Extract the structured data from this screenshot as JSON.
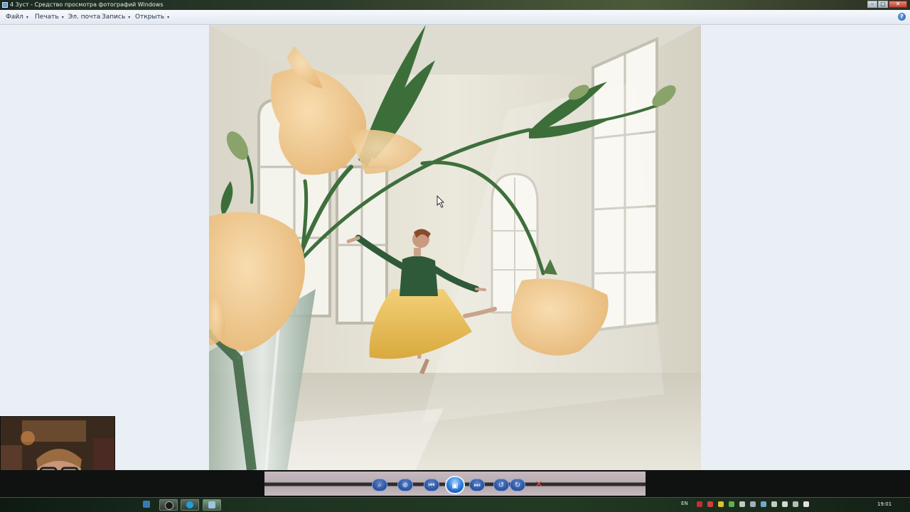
{
  "window": {
    "title": "4 3уст - Средство просмотра фотографий Windows",
    "controls": [
      "minimize",
      "maximize",
      "close"
    ]
  },
  "menubar": {
    "items": [
      {
        "label": "Файл",
        "has_dropdown": true
      },
      {
        "label": "Печать",
        "has_dropdown": true
      },
      {
        "label": "Эл. почта",
        "has_dropdown": false
      },
      {
        "label": "Запись",
        "has_dropdown": true
      },
      {
        "label": "Открыть",
        "has_dropdown": true
      }
    ],
    "help_icon": "help-icon",
    "dropdown_arrow": "▾"
  },
  "photo": {
    "subject": "ballerina-in-yellow-skirt-with-flowers",
    "colors": {
      "wall": "#e6e2d6",
      "floor": "#dcd8cc",
      "flower": "#f1c98c",
      "stem": "#3c6e3a",
      "skirt": "#e9c25a",
      "jacket": "#2f5a3a"
    }
  },
  "toolbar": {
    "buttons": [
      {
        "name": "zoom-icon",
        "glyph": "⌕"
      },
      {
        "name": "actual-size-icon",
        "glyph": "⊕"
      },
      {
        "name": "previous-icon",
        "glyph": "⏮"
      },
      {
        "name": "slideshow-icon",
        "glyph": "▣"
      },
      {
        "name": "next-icon",
        "glyph": "⏭"
      },
      {
        "name": "rotate-left-icon",
        "glyph": "↺"
      },
      {
        "name": "rotate-right-icon",
        "glyph": "↻"
      },
      {
        "name": "delete-icon",
        "glyph": "✕"
      }
    ]
  },
  "taskbar": {
    "language": "EN",
    "clock": "19:01",
    "pinned": [
      "start-button",
      "explorer-icon",
      "media-player-icon",
      "skype-icon",
      "photo-viewer-icon"
    ],
    "tray": [
      "opera-icon",
      "security-icon",
      "network-icon",
      "volume-icon",
      "update-icon",
      "display-icon",
      "clipboard-icon",
      "sync-icon",
      "flag-icon",
      "battery-icon",
      "power-icon"
    ]
  }
}
